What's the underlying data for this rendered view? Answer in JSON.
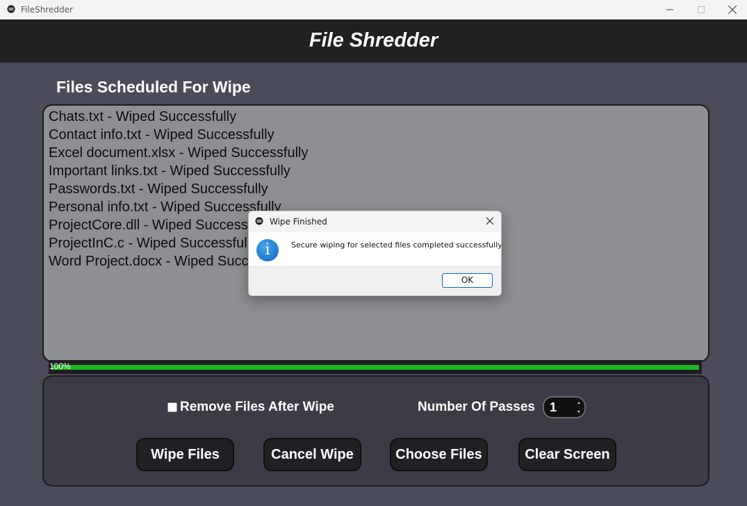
{
  "window": {
    "title": "FileShredder"
  },
  "header": {
    "title": "File Shredder"
  },
  "file_list": {
    "title": "Files Scheduled For Wipe",
    "lines": [
      "Chats.txt - Wiped Successfully",
      "Contact info.txt - Wiped Successfully",
      "Excel document.xlsx - Wiped Successfully",
      "Important links.txt - Wiped Successfully",
      "Passwords.txt - Wiped Successfully",
      "Personal info.txt - Wiped Successfully",
      "ProjectCore.dll - Wiped Successfully",
      "ProjectInC.c - Wiped Successfully",
      "Word Project.docx - Wiped Successfully"
    ]
  },
  "progress": {
    "label": "100%",
    "value": 1.0,
    "color": "#1fb423"
  },
  "controls": {
    "remove_after_wipe_label": "Remove Files After Wipe",
    "remove_after_wipe_checked": false,
    "passes_label": "Number Of Passes",
    "passes_value": "1",
    "buttons": {
      "wipe": "Wipe Files",
      "cancel": "Cancel Wipe",
      "choose": "Choose Files",
      "clear": "Clear Screen"
    }
  },
  "dialog": {
    "title": "Wipe Finished",
    "message": "Secure wiping for selected files completed successfully.",
    "ok_label": "OK",
    "icon": "info-icon"
  },
  "colors": {
    "header_bg": "#202123",
    "app_bg": "#4b4c59",
    "list_bg": "#8e8f93",
    "button_bg": "#202124"
  }
}
